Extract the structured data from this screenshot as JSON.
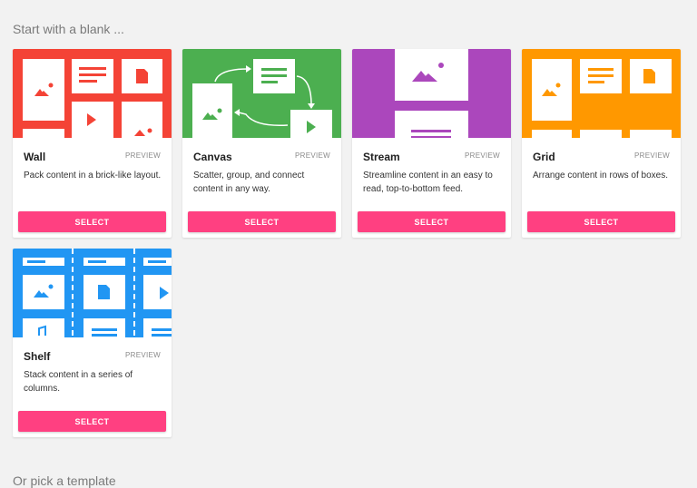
{
  "sections": {
    "blank_title": "Start with a blank ...",
    "template_title": "Or pick a template"
  },
  "cards": [
    {
      "title": "Wall",
      "preview": "PREVIEW",
      "description": "Pack content in a brick-like layout.",
      "select": "SELECT",
      "color": "#f44336"
    },
    {
      "title": "Canvas",
      "preview": "PREVIEW",
      "description": "Scatter, group, and connect content in any way.",
      "select": "SELECT",
      "color": "#4caf50"
    },
    {
      "title": "Stream",
      "preview": "PREVIEW",
      "description": "Streamline content in an easy to read, top-to-bottom feed.",
      "select": "SELECT",
      "color": "#ab47bc"
    },
    {
      "title": "Grid",
      "preview": "PREVIEW",
      "description": "Arrange content in rows of boxes.",
      "select": "SELECT",
      "color": "#ff9800"
    },
    {
      "title": "Shelf",
      "preview": "PREVIEW",
      "description": "Stack content in a series of columns.",
      "select": "SELECT",
      "color": "#2196f3"
    }
  ],
  "colors": {
    "accent": "#ff4081",
    "background": "#f2f2f2"
  }
}
